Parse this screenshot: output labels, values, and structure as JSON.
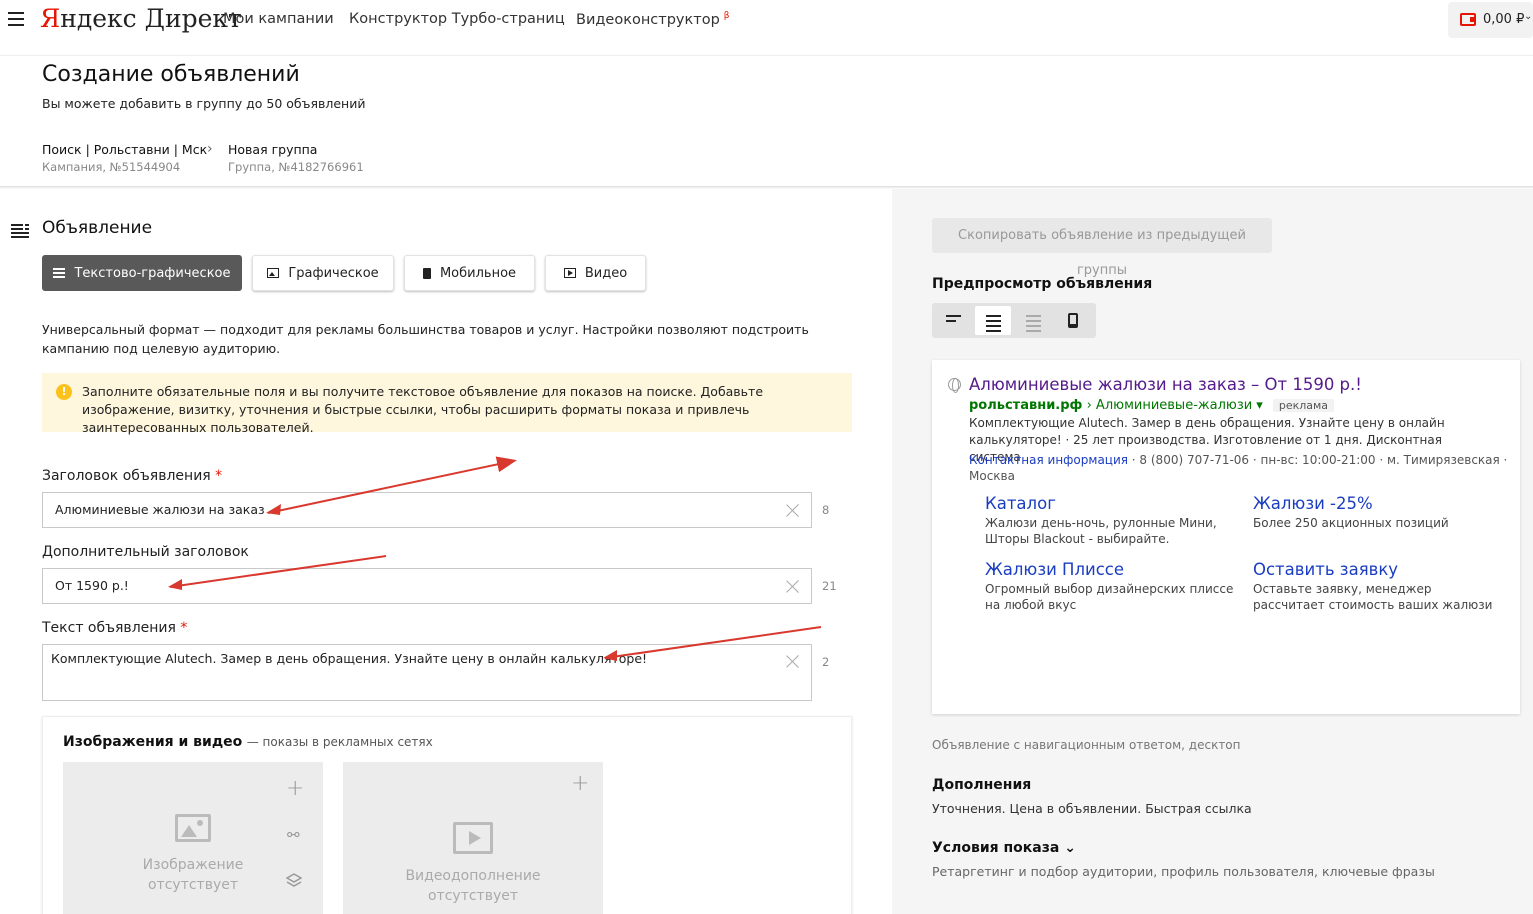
{
  "header": {
    "logo_first": "Я",
    "logo_rest": "ндекс Директ",
    "nav": [
      "Мои кампании",
      "Конструктор Турбо-страниц",
      "Видеоконструктор"
    ],
    "beta_mark": "β",
    "balance": "0,00 ₽",
    "balance_chevron": "⌄"
  },
  "page": {
    "title": "Создание объявлений",
    "subtitle": "Вы можете добавить в группу до 50 объявлений",
    "breadcrumb": {
      "campaign_name": "Поиск | Рольставни | Мск",
      "campaign_id": "Кампания, №51544904",
      "separator": "›",
      "group_name": "Новая группа",
      "group_id": "Группа, №4182766961"
    }
  },
  "ad_section": {
    "title": "Объявление",
    "formats": [
      "Текстово-графическое",
      "Графическое",
      "Мобильное",
      "Видео"
    ],
    "active_format": "Текстово-графическое",
    "description": "Универсальный формат — подходит для рекламы большинства товаров и услуг. Настройки позволяют подстроить кампанию под целевую аудиторию.",
    "notice_icon": "!",
    "notice": "Заполните обязательные поля и вы получите текстовое объявление для показов на поиске. Добавьте изображение, визитку, уточнения и быстрые ссылки, чтобы расширить форматы показа и привлечь заинтересованных пользователей.",
    "fields": {
      "headline_label": "Заголовок объявления",
      "headline_value": "Алюминиевые жалюзи на заказ",
      "headline_counter": "8",
      "extra_label": "Дополнительный заголовок",
      "extra_value": "От 1590 р.!",
      "extra_counter": "21",
      "text_label": "Текст объявления",
      "text_value": "Комплектующие Alutech. Замер в день обращения. Узнайте цену в онлайн калькуляторе!",
      "text_counter": "2",
      "required_mark": "*"
    },
    "media": {
      "title": "Изображения и видео",
      "subtitle": "— показы в рекламных сетях",
      "image_empty": "Изображение отсутствует",
      "video_empty": "Видеодополнение отсутствует",
      "plus": "+"
    }
  },
  "preview": {
    "copy_button": "Скопировать объявление из предыдущей группы",
    "title": "Предпросмотр объявления",
    "active_view": 1,
    "ad": {
      "title": "Алюминиевые жалюзи на заказ – От 1590 р.!",
      "domain": "рольставни.рф",
      "path": "› Алюминиевые-жалюзи ▾",
      "tag": "реклама",
      "text": "Комплектующие Alutech. Замер в день обращения. Узнайте цену в онлайн калькуляторе! · 25 лет производства. Изготовление от 1 дня. Дисконтная система",
      "contact_link": "Контактная информация",
      "contacts": " · 8 (800) 707-71-06 · пн-вс: 10:00-21:00 · м. Тимирязевская · Москва",
      "sitelinks": [
        {
          "title": "Каталог",
          "desc": "Жалюзи день-ночь, рулонные Мини, Шторы Blackout - выбирайте."
        },
        {
          "title": "Жалюзи -25%",
          "desc": "Более 250 акционных позиций"
        },
        {
          "title": "Жалюзи Плиссе",
          "desc": "Огромный выбор дизайнерских плиссе на любой вкус"
        },
        {
          "title": "Оставить заявку",
          "desc": "Оставьте заявку, менеджер рассчитает стоимость ваших жалюзи"
        }
      ]
    },
    "note": "Объявление с навигационным ответом, десктоп",
    "additions_title": "Дополнения",
    "additions_text": "Уточнения. Цена в объявлении. Быстрая ссылка",
    "conditions_title": "Условия показа",
    "conditions_chevron": "⌄",
    "conditions_text": "Ретаргетинг и подбор аудитории, профиль пользователя, ключевые фразы"
  },
  "colors": {
    "accent_red": "#e61400",
    "annotation_arrow": "#d8382e",
    "visited_link": "#551a8b",
    "link": "#1a3dc1",
    "url_green": "#007700",
    "notice_bg": "#fef7dd",
    "notice_icon": "#fcc21b"
  }
}
